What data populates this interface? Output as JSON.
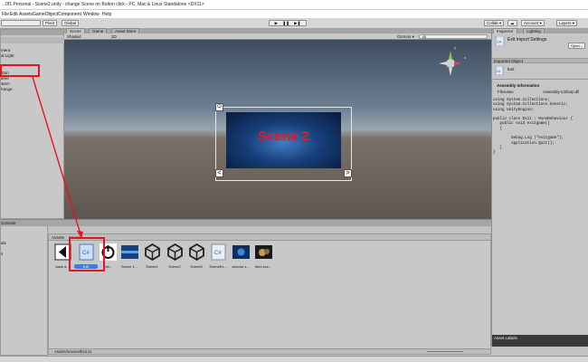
{
  "window": {
    "title": "...0f1 Personal - Scene2.unity - change Scene on Button click - PC, Mac & Linux Standalone <DX11>"
  },
  "menu": [
    "File",
    "Edit",
    "Assets",
    "GameObject",
    "Component",
    "Window",
    "Help"
  ],
  "toolbar": {
    "pivot_label": "Pivot",
    "global_label": "Global",
    "collab_label": "Collab ▾",
    "account_label": "Account ▾",
    "layers_label": "Layers ▾",
    "layout_label": "Layout"
  },
  "hierarchy": {
    "items": [
      {
        "label": "mera"
      },
      {
        "label": "al Light"
      },
      {
        "label": ""
      },
      {
        "label": "ttton"
      },
      {
        "label": "ame"
      },
      {
        "label": "stem"
      },
      {
        "label": "hange"
      }
    ]
  },
  "scene_tabs": {
    "scene": "Scene",
    "game": "Game",
    "store": "Asset Store"
  },
  "scene_toolbar": {
    "shading": "Shaded",
    "mode": "2D",
    "gizmos": "Gizmos ▾",
    "search": "All"
  },
  "scene_view": {
    "banner_text": "Scene 2",
    "gizmo_axis_x": "x",
    "gizmo_axis_y": "y",
    "prev": "<",
    "next": ">"
  },
  "console": {
    "label": "Console"
  },
  "project_sidebar": {
    "items": [
      "als",
      "",
      "s"
    ]
  },
  "project": {
    "breadcrumb_assets": "Assets",
    "breadcrumb_scenes": "Scenes",
    "path": "Assets/Scenes/Exit.cs",
    "assets": [
      {
        "label": "back a...",
        "icon": "back-arrow-icon"
      },
      {
        "label": "Exit",
        "icon": "csharp-script-icon",
        "selected": true
      },
      {
        "label": "Exit...",
        "icon": "power-icon"
      },
      {
        "label": "Scene 1...",
        "icon": "scene-thumbnail-icon"
      },
      {
        "label": "Scene1",
        "icon": "unity-scene-icon"
      },
      {
        "label": "Scene2",
        "icon": "unity-scene-icon"
      },
      {
        "label": "Scene3",
        "icon": "unity-scene-icon"
      },
      {
        "label": "SceneEx...",
        "icon": "csharp-script-icon"
      },
      {
        "label": "second s...",
        "icon": "image-thumbnail-icon"
      },
      {
        "label": "third sce...",
        "icon": "image-thumbnail-icon"
      }
    ]
  },
  "inspector": {
    "tab_inspector": "Inspector",
    "tab_lighting": "Lighting",
    "header": "Exit Import Settings",
    "open_label": "Open...",
    "imported_object": "Imported Object",
    "object_name": "Exit",
    "assembly_title": "Assembly Information",
    "filename_label": "Filename",
    "filename_value": "Assembly-CSharp.dll",
    "code": "using System.Collections;\nusing System.Collections.Generic;\nusing UnityEngine;\n\npublic class Exit : MonoBehaviour {\n   public void exitgame()\n   {\n\n        Debug.Log (\"exitgame\");\n        Application.Quit();\n   }\n}",
    "asset_labels": "Asset Labels"
  },
  "colors": {
    "annotation_red": "#e5161b",
    "banner_red": "#e21b1b",
    "selection_blue": "#3f7fd6"
  }
}
